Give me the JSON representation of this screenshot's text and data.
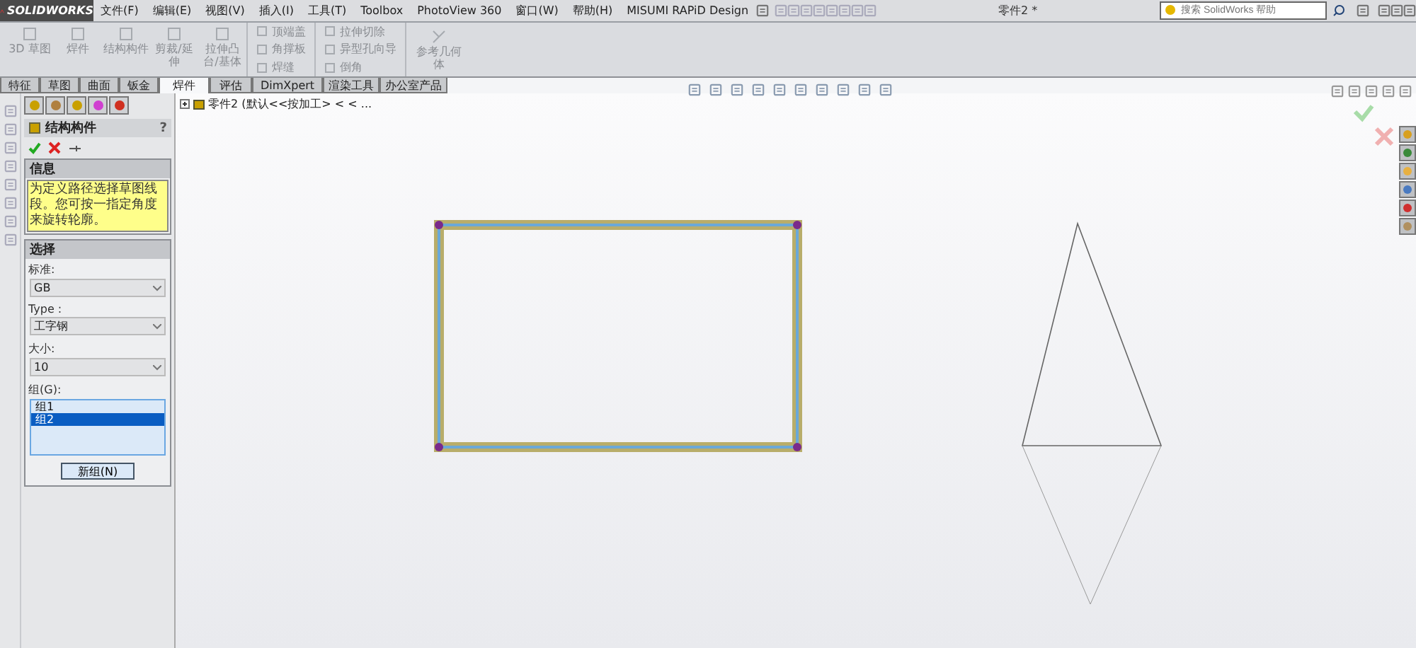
{
  "app": {
    "logo": "SOLIDWORKS",
    "title": "零件2 *"
  },
  "menu": [
    "文件(F)",
    "编辑(E)",
    "视图(V)",
    "插入(I)",
    "工具(T)",
    "Toolbox",
    "PhotoView 360",
    "窗口(W)",
    "帮助(H)",
    "MISUMI RAPiD Design"
  ],
  "search": {
    "placeholder": "搜索 SolidWorks 帮助"
  },
  "ribbon": {
    "large": [
      "3D 草图",
      "焊件",
      "结构构件",
      "剪裁/延伸",
      "拉伸凸台/基体"
    ],
    "small_columns": [
      [
        "顶端盖",
        "角撑板",
        "焊缝"
      ],
      [
        "拉伸切除",
        "异型孔向导",
        "倒角"
      ]
    ],
    "reference": "参考几何体"
  },
  "tabs": [
    {
      "label": "特征",
      "selected": false
    },
    {
      "label": "草图",
      "selected": false
    },
    {
      "label": "曲面",
      "selected": false
    },
    {
      "label": "钣金",
      "selected": false
    },
    {
      "label": "焊件",
      "selected": true
    },
    {
      "label": "评估",
      "selected": false
    },
    {
      "label": "DimXpert",
      "selected": false
    },
    {
      "label": "渲染工具",
      "selected": false
    },
    {
      "label": "办公室产品",
      "selected": false
    }
  ],
  "property": {
    "title": "结构构件",
    "help": "?",
    "info": {
      "title": "信息",
      "text": "为定义路径选择草图线段。您可按一指定角度来旋转轮廓。"
    },
    "selection": {
      "title": "选择",
      "fields": [
        {
          "label": "标准:",
          "value": "GB"
        },
        {
          "label": "Type :",
          "value": "工字钢"
        },
        {
          "label": "大小:",
          "value": "10"
        }
      ],
      "groups_label": "组(G):",
      "groups": [
        {
          "label": "组1",
          "selected": false
        },
        {
          "label": "组2",
          "selected": true
        }
      ],
      "new_group": "新组(N)"
    }
  },
  "tree": {
    "label": "零件2 (默认<<按加工> < < ..."
  }
}
